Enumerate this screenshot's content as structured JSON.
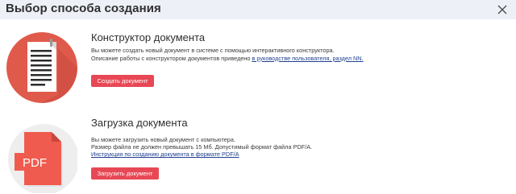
{
  "dialog": {
    "title": "Выбор способа создания"
  },
  "constructor": {
    "title": "Конструктор документа",
    "line1": "Вы можете создать новый документ в системе с помощью интерактивного конструктора.",
    "line2_prefix": "Описание работы с конструктором документов приведено ",
    "line2_link": "в руководстве пользователя, раздел NN.",
    "button_label": "Создать документ"
  },
  "upload": {
    "title": "Загрузка документа",
    "line1": "Вы можете загрузить новый документ с компьютера.",
    "line2": "Размер файла не должен превышать 15 Мб. Допустимый формат файла PDF/A.",
    "link": "Инструкция по созданию документа в формате PDF/A",
    "button_label": "Загрузить документ",
    "icon_text": "PDF"
  },
  "colors": {
    "accent": "#e84855",
    "header_bg": "#eef0f7",
    "link": "#1f3f8f"
  },
  "icons": {
    "close": "close-icon",
    "document": "document-icon",
    "pdf": "pdf-file-icon"
  }
}
